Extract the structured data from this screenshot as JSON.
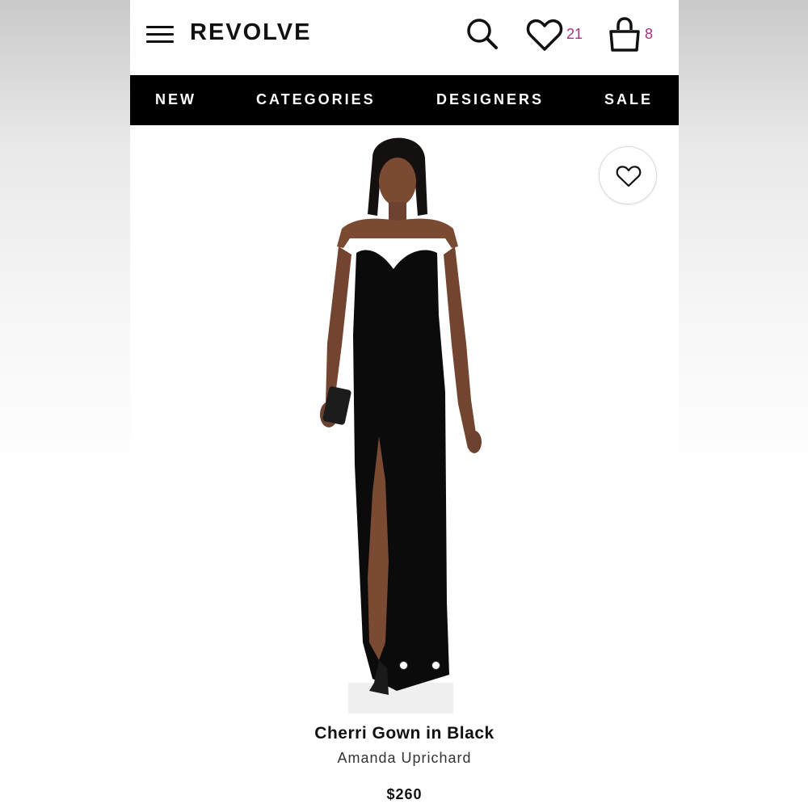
{
  "header": {
    "logo": "REVOLVE",
    "wishlist_count": "21",
    "bag_count": "8",
    "accent_color": "#a8327e",
    "icons": [
      "menu-icon",
      "search-icon",
      "heart-icon",
      "shopping-bag-icon"
    ]
  },
  "nav": {
    "items": [
      {
        "label": "NEW"
      },
      {
        "label": "CATEGORIES"
      },
      {
        "label": "DESIGNERS"
      },
      {
        "label": "SALE"
      }
    ]
  },
  "product": {
    "title": "Cherri Gown in Black",
    "designer": "Amanda Uprichard",
    "price": "$260",
    "gallery_dot_count": 2
  }
}
